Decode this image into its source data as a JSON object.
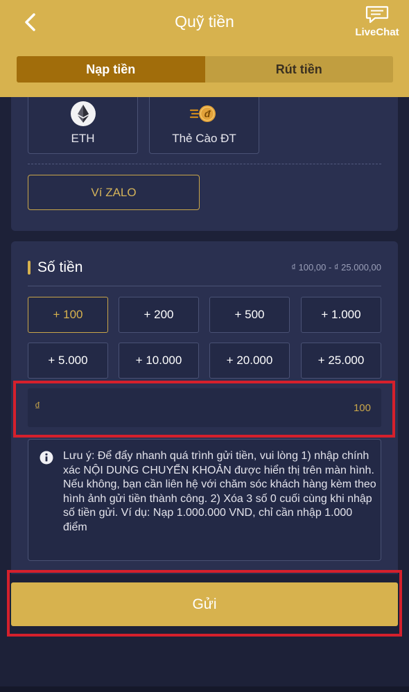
{
  "header": {
    "title": "Quỹ tiền",
    "livechat_label": "LiveChat"
  },
  "tabs": [
    {
      "label": "Nạp tiền",
      "active": true
    },
    {
      "label": "Rút tiền",
      "active": false
    }
  ],
  "methods": [
    {
      "label": "ETH",
      "icon": "ethereum-icon"
    },
    {
      "label": "Thẻ Cào ĐT",
      "icon": "phone-card-icon"
    }
  ],
  "zalo_label": "Ví ZALO",
  "amount": {
    "title": "Số tiền",
    "range": "₫ 100,00 - ₫ 25.000,00",
    "chips": [
      "+ 100",
      "+ 200",
      "+ 500",
      "+ 1.000",
      "+ 5.000",
      "+ 10.000",
      "+ 20.000",
      "+ 25.000"
    ],
    "selected_chip": "+ 100",
    "currency_symbol": "₫",
    "value": "100"
  },
  "notice": {
    "text": "Lưu ý: Để đẩy nhanh quá trình gửi tiền, vui lòng 1) nhập chính xác NỘI DUNG CHUYỂN KHOẢN được hiển thị trên màn hình. Nếu không, bạn cần liên hệ với chăm sóc khách hàng kèm theo hình ảnh gửi tiền thành công. 2) Xóa 3 số 0 cuối cùng khi nhập số tiền gửi. Ví dụ: Nạp 1.000.000 VND, chỉ cần nhập 1.000 điểm"
  },
  "submit_label": "Gửi",
  "colors": {
    "gold": "#d7b24e",
    "dark_gold": "#a16d0b",
    "background": "#1d2138",
    "card": "#2a3050",
    "highlight_red": "#d5202c"
  }
}
